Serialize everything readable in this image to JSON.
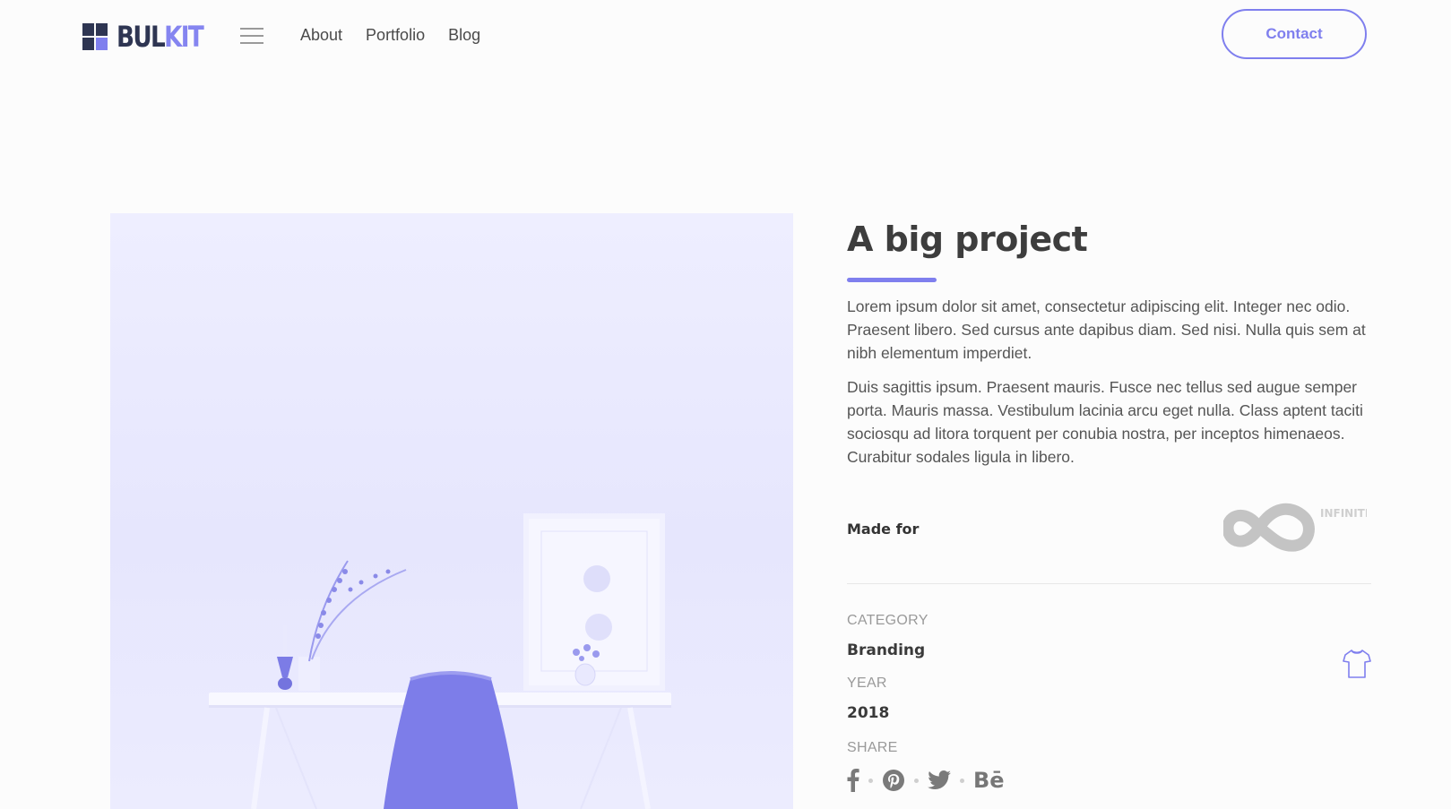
{
  "brand": {
    "logo_dark": "BUL",
    "logo_light": "KIT",
    "accent": "#7f7fee",
    "dark": "#2e3552"
  },
  "nav": {
    "links": [
      "About",
      "Portfolio",
      "Blog"
    ],
    "contact_label": "Contact",
    "menu_icon": "hamburger-icon"
  },
  "project": {
    "title": "A big project",
    "paragraphs": [
      "Lorem ipsum dolor sit amet, consectetur adipiscing elit. Integer nec odio. Praesent libero. Sed cursus ante dapibus diam. Sed nisi. Nulla quis sem at nibh elementum imperdiet.",
      "Duis sagittis ipsum. Praesent mauris. Fusce nec tellus sed augue semper porta. Mauris massa. Vestibulum lacinia arcu eget nulla. Class aptent taciti sociosqu ad litora torquent per conubia nostra, per inceptos himenaeos. Curabitur sodales ligula in libero."
    ],
    "made_for_label": "Made for",
    "client_logo_text": "INFINITE",
    "category_label": "CATEGORY",
    "category_value": "Branding",
    "category_icon": "tshirt-icon",
    "year_label": "YEAR",
    "year_value": "2018",
    "share_label": "SHARE",
    "share_icons": [
      "facebook-icon",
      "pinterest-icon",
      "twitter-icon",
      "behance-icon"
    ],
    "behance_text": "Bē"
  }
}
